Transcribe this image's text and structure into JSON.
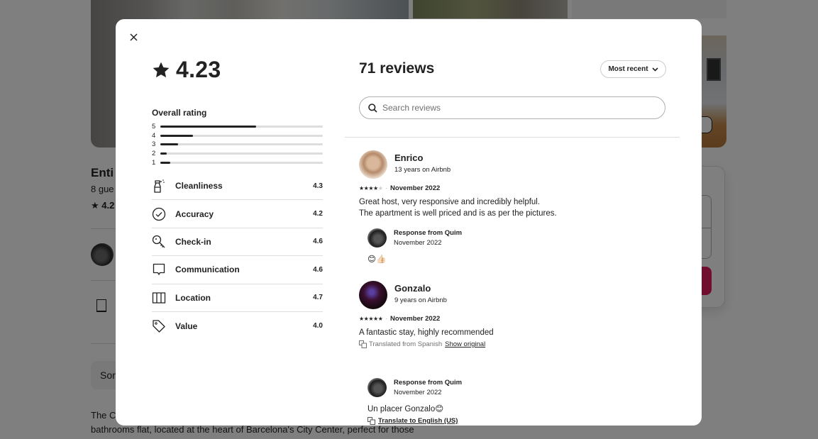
{
  "background_page": {
    "listing_title_partial": "Enti",
    "listing_subtitle_partial": "8 gue",
    "listing_rating_partial": "4.2",
    "translate_notice_partial": "Son",
    "description_line1_partial": "The C",
    "description_line2": "bathrooms flat, located at the heart of Barcelona's City Center, perfect for those",
    "brand_color": "#e31c5f"
  },
  "modal": {
    "close_icon": "close-icon",
    "overall": {
      "rating": "4.23",
      "star_icon": "star-icon",
      "label": "Overall rating",
      "distribution": [
        {
          "stars": "5",
          "fraction": 0.59
        },
        {
          "stars": "4",
          "fraction": 0.2
        },
        {
          "stars": "3",
          "fraction": 0.11
        },
        {
          "stars": "2",
          "fraction": 0.04
        },
        {
          "stars": "1",
          "fraction": 0.06
        }
      ]
    },
    "categories": [
      {
        "name": "Cleanliness",
        "value": "4.3",
        "icon": "spray-bottle-icon"
      },
      {
        "name": "Accuracy",
        "value": "4.2",
        "icon": "check-circle-icon"
      },
      {
        "name": "Check-in",
        "value": "4.6",
        "icon": "key-icon"
      },
      {
        "name": "Communication",
        "value": "4.6",
        "icon": "speech-bubble-icon"
      },
      {
        "name": "Location",
        "value": "4.7",
        "icon": "map-icon"
      },
      {
        "name": "Value",
        "value": "4.0",
        "icon": "tag-icon"
      }
    ],
    "reviews_header": {
      "title": "71 reviews",
      "sort_label": "Most recent",
      "search_placeholder": "Search reviews",
      "search_value": ""
    },
    "reviews": [
      {
        "name": "Enrico",
        "tenure": "13 years on Airbnb",
        "stars": 4,
        "date": "November 2022",
        "text_lines": [
          "Great host, very responsive and incredibly helpful.",
          "The apartment is well priced and is as per the pictures."
        ],
        "response": {
          "from": "Response from Quim",
          "date": "November 2022",
          "text": "😊👍🏻"
        }
      },
      {
        "name": "Gonzalo",
        "tenure": "9 years on Airbnb",
        "stars": 5,
        "date": "November 2022",
        "text_lines": [
          "A fantastic stay, highly recommended"
        ],
        "translated_note": "Translated from Spanish",
        "show_original_label": "Show original",
        "response": {
          "from": "Response from Quim",
          "date": "November 2022",
          "text": "Un placer Gonzalo😊",
          "translate_label": "Translate to English (US)"
        }
      }
    ]
  }
}
